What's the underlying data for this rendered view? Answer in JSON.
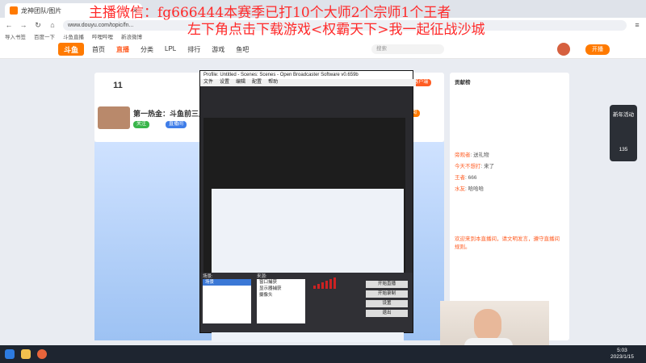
{
  "browser": {
    "tab_title": "龙神团队/图片",
    "url": "www.douyu.com/topic/fn...",
    "bookmarks": [
      "导入书签",
      "百度一下",
      "斗鱼直播",
      "哔哩哔哩",
      "新浪微博"
    ]
  },
  "site": {
    "logo": "斗鱼",
    "nav": [
      "首页",
      "直播",
      "分类",
      "LPL",
      "排行",
      "游戏",
      "鱼吧"
    ],
    "search_placeholder": "搜索",
    "open_button": "开播"
  },
  "stream": {
    "rank_number": "11",
    "title": "第一热金：斗鱼前三上单！",
    "tag1": "关注",
    "tag2": "直播间",
    "follow_btn": "订阅",
    "pc_btn": "PC客户端"
  },
  "chat": {
    "header": "贡献榜",
    "rows": [
      {
        "name": "旁观者",
        "text": "送礼物"
      },
      {
        "name": "今天不想打",
        "text": "来了"
      },
      {
        "name": "王者",
        "text": "666"
      },
      {
        "name": "水友",
        "text": "哈哈哈"
      }
    ],
    "notice": "欢迎来到本直播间，请文明发言，遵守直播间规则。"
  },
  "rail": {
    "label": "新年活动",
    "count": "135"
  },
  "obs": {
    "title": "Profile: Untitled - Scenes: Scenes - Open Broadcaster Software v0.659b",
    "menu": [
      "文件",
      "设置",
      "编辑",
      "配置",
      "帮助"
    ],
    "scenes_label": "场景:",
    "scene_item": "场景",
    "sources_label": "来源:",
    "sources": [
      "窗口捕获",
      "显示器捕获",
      "摄像头"
    ],
    "buttons": [
      "开始直播",
      "开始录制",
      "设置",
      "退出"
    ]
  },
  "overlay": {
    "line1": "主播微信：fg666444本赛季已打10个大师2个宗师1个王者",
    "line2": "左下角点击下载游戏<权霸天下>我一起征战沙城"
  },
  "taskbar": {
    "time": "5:03",
    "date": "2023/1/15"
  }
}
